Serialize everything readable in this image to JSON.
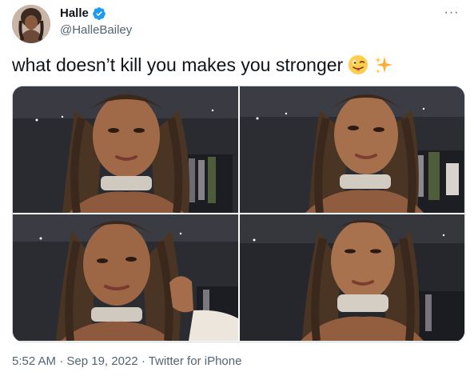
{
  "tweet": {
    "display_name": "Halle",
    "handle": "@HalleBailey",
    "text": "what doesn’t kill you makes you stronger",
    "emojis": [
      "winking-face-with-tongue-emoji",
      "sparkles-emoji"
    ],
    "more_label": "···",
    "footer": {
      "time": "5:52 AM",
      "separator": "·",
      "date": "Sep 19, 2022",
      "source": "Twitter for iPhone"
    }
  },
  "colors": {
    "text_primary": "#0f1419",
    "text_secondary": "#536471",
    "verified_blue": "#1d9bf0",
    "border": "#cfd9de"
  },
  "media": {
    "photos": [
      {
        "name": "photo-1"
      },
      {
        "name": "photo-2"
      },
      {
        "name": "photo-3"
      },
      {
        "name": "photo-4"
      }
    ]
  }
}
